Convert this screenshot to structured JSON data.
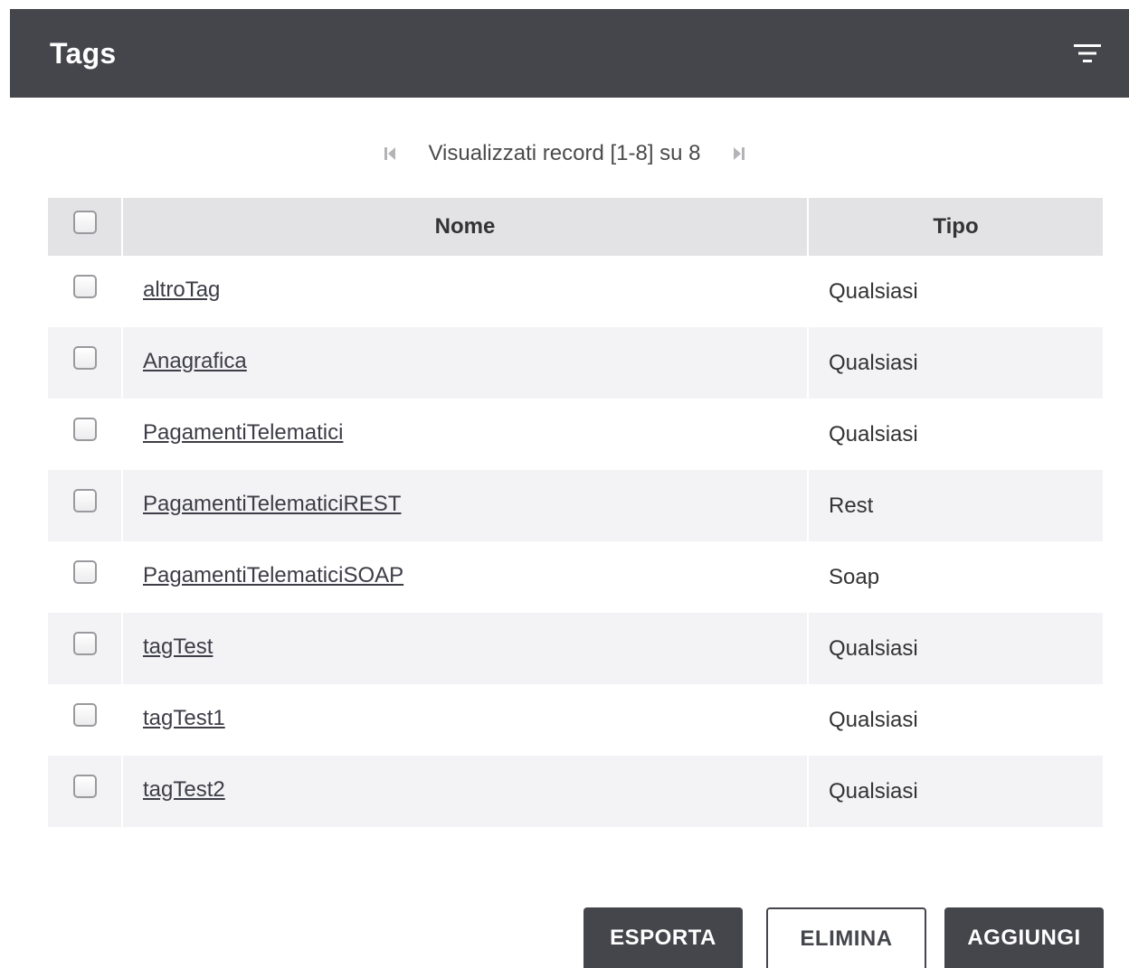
{
  "header": {
    "title": "Tags",
    "filter_icon": "filter-icon"
  },
  "pager": {
    "text": "Visualizzati record [1-8] su 8",
    "first_icon": "first-page-icon",
    "last_icon": "last-page-icon"
  },
  "table": {
    "columns": {
      "name": "Nome",
      "type": "Tipo"
    },
    "rows": [
      {
        "name": "altroTag",
        "type": "Qualsiasi"
      },
      {
        "name": "Anagrafica",
        "type": "Qualsiasi"
      },
      {
        "name": "PagamentiTelematici",
        "type": "Qualsiasi"
      },
      {
        "name": "PagamentiTelematiciREST",
        "type": "Rest"
      },
      {
        "name": "PagamentiTelematiciSOAP",
        "type": "Soap"
      },
      {
        "name": "tagTest",
        "type": "Qualsiasi"
      },
      {
        "name": "tagTest1",
        "type": "Qualsiasi"
      },
      {
        "name": "tagTest2",
        "type": "Qualsiasi"
      }
    ]
  },
  "buttons": {
    "export": "ESPORTA",
    "delete": "ELIMINA",
    "add": "AGGIUNGI"
  },
  "colors": {
    "header_bg": "#45464c",
    "table_header_bg": "#e3e3e6",
    "row_alt_bg": "#f3f3f5"
  }
}
